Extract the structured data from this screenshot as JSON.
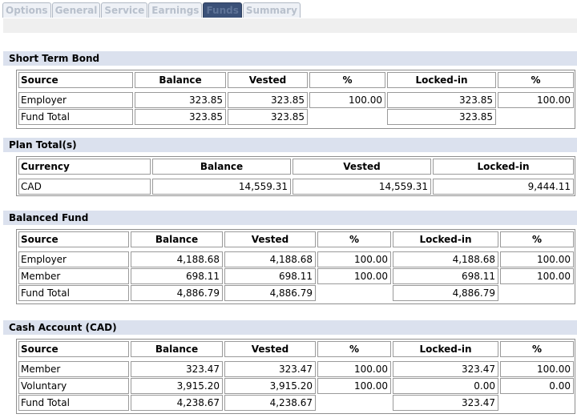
{
  "tabs": [
    {
      "label": "Options"
    },
    {
      "label": "General"
    },
    {
      "label": "Service"
    },
    {
      "label": "Earnings"
    },
    {
      "label": "Funds"
    },
    {
      "label": "Summary"
    }
  ],
  "short_term_bond": {
    "title": "Short Term Bond",
    "headers": {
      "source": "Source",
      "balance": "Balance",
      "vested": "Vested",
      "pct": "%",
      "locked": "Locked-in",
      "lpct": "%"
    },
    "rows": [
      {
        "source": "Employer",
        "balance": "323.85",
        "vested": "323.85",
        "pct": "100.00",
        "locked": "323.85",
        "lpct": "100.00"
      },
      {
        "source": "Fund Total",
        "balance": "323.85",
        "vested": "323.85",
        "locked": "323.85"
      }
    ]
  },
  "plan_totals": {
    "title": "Plan Total(s)",
    "headers": {
      "currency": "Currency",
      "balance": "Balance",
      "vested": "Vested",
      "locked": "Locked-in"
    },
    "rows": [
      {
        "currency": "CAD",
        "balance": "14,559.31",
        "vested": "14,559.31",
        "locked": "9,444.11"
      }
    ]
  },
  "balanced_fund": {
    "title": "Balanced Fund",
    "headers": {
      "source": "Source",
      "balance": "Balance",
      "vested": "Vested",
      "pct": "%",
      "locked": "Locked-in",
      "lpct": "%"
    },
    "rows": [
      {
        "source": "Employer",
        "balance": "4,188.68",
        "vested": "4,188.68",
        "pct": "100.00",
        "locked": "4,188.68",
        "lpct": "100.00"
      },
      {
        "source": "Member",
        "balance": "698.11",
        "vested": "698.11",
        "pct": "100.00",
        "locked": "698.11",
        "lpct": "100.00"
      },
      {
        "source": "Fund Total",
        "balance": "4,886.79",
        "vested": "4,886.79",
        "locked": "4,886.79"
      }
    ]
  },
  "cash_account": {
    "title": "Cash Account (CAD)",
    "headers": {
      "source": "Source",
      "balance": "Balance",
      "vested": "Vested",
      "pct": "%",
      "locked": "Locked-in",
      "lpct": "%"
    },
    "rows": [
      {
        "source": "Member",
        "balance": "323.47",
        "vested": "323.47",
        "pct": "100.00",
        "locked": "323.47",
        "lpct": "100.00"
      },
      {
        "source": "Voluntary",
        "balance": "3,915.20",
        "vested": "3,915.20",
        "pct": "100.00",
        "locked": "0.00",
        "lpct": "0.00"
      },
      {
        "source": "Fund Total",
        "balance": "4,238.67",
        "vested": "4,238.67",
        "locked": "323.47"
      }
    ]
  }
}
